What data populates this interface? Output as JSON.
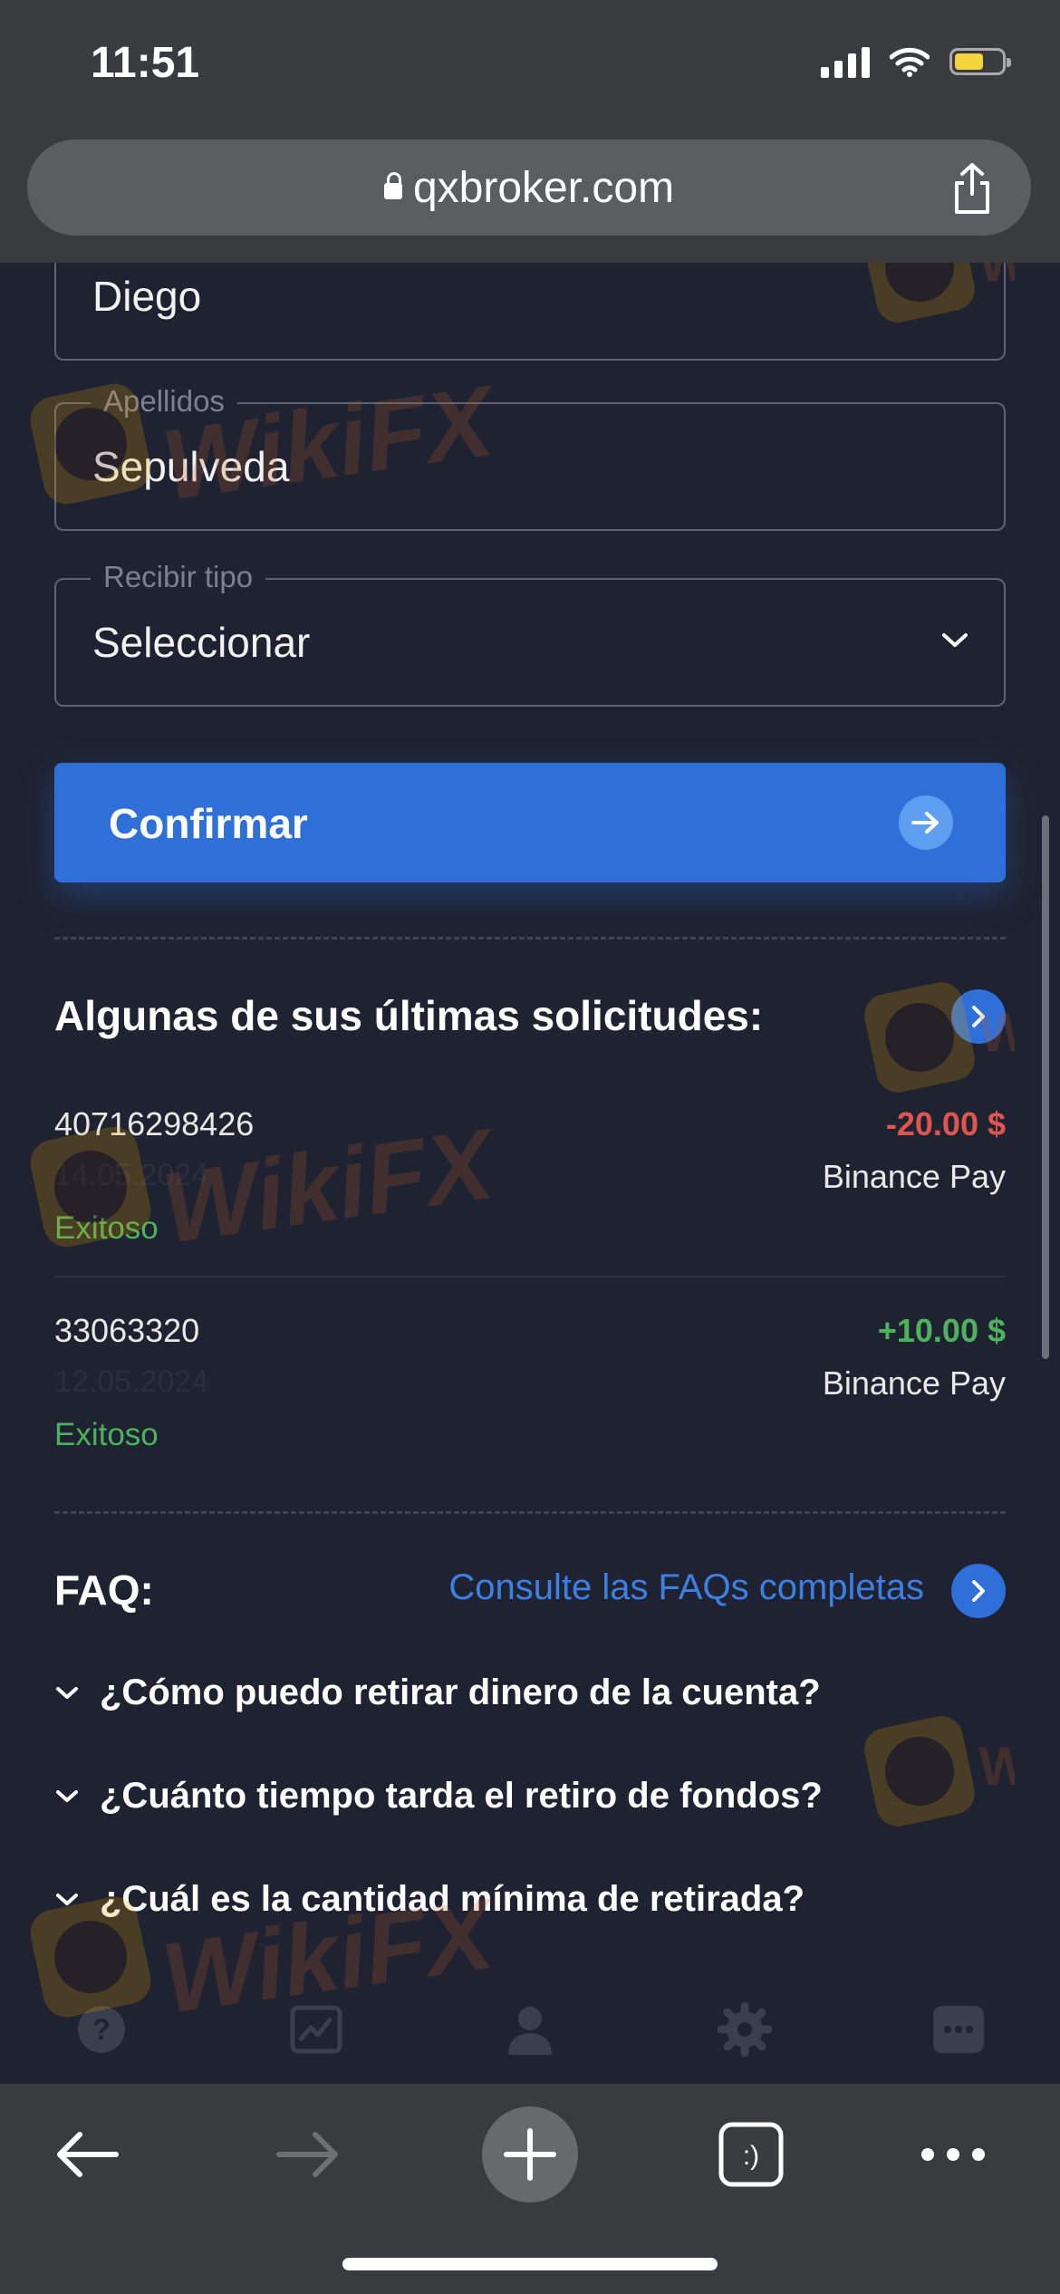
{
  "status_bar": {
    "time": "11:51"
  },
  "browser": {
    "url": "qxbroker.com"
  },
  "form": {
    "first_name_value": "Diego",
    "last_name_label": "Apellidos",
    "last_name_value": "Sepulveda",
    "receive_type_label": "Recibir tipo",
    "receive_type_value": "Seleccionar",
    "confirm_label": "Confirmar"
  },
  "requests": {
    "title": "Algunas de sus últimas solicitudes:",
    "items": [
      {
        "id": "40716298426",
        "date": "14.05.2024",
        "status": "Exitoso",
        "amount": "-20.00 $",
        "method": "Binance Pay"
      },
      {
        "id": "33063320",
        "date": "12.05.2024",
        "status": "Exitoso",
        "amount": "+10.00 $",
        "method": "Binance Pay"
      }
    ]
  },
  "faq": {
    "title": "FAQ:",
    "link_label": "Consulte las FAQs completas",
    "questions": [
      "¿Cómo puedo retirar dinero de la cuenta?",
      "¿Cuánto tiempo tarda el retiro de fondos?",
      "¿Cuál es la cantidad mínima de retirada?"
    ]
  },
  "watermark": {
    "text": "WikiFX"
  },
  "colors": {
    "negative": "#e0564f",
    "positive": "#4cb25e",
    "accent": "#2f6fd8"
  },
  "icons": {
    "app_nav": [
      "question-icon",
      "chart-icon",
      "profile-icon",
      "settings-icon",
      "chat-icon"
    ],
    "browser_nav": [
      "back-arrow-icon",
      "forward-arrow-icon",
      "new-tab-icon",
      "tabs-icon",
      "more-icon"
    ]
  }
}
